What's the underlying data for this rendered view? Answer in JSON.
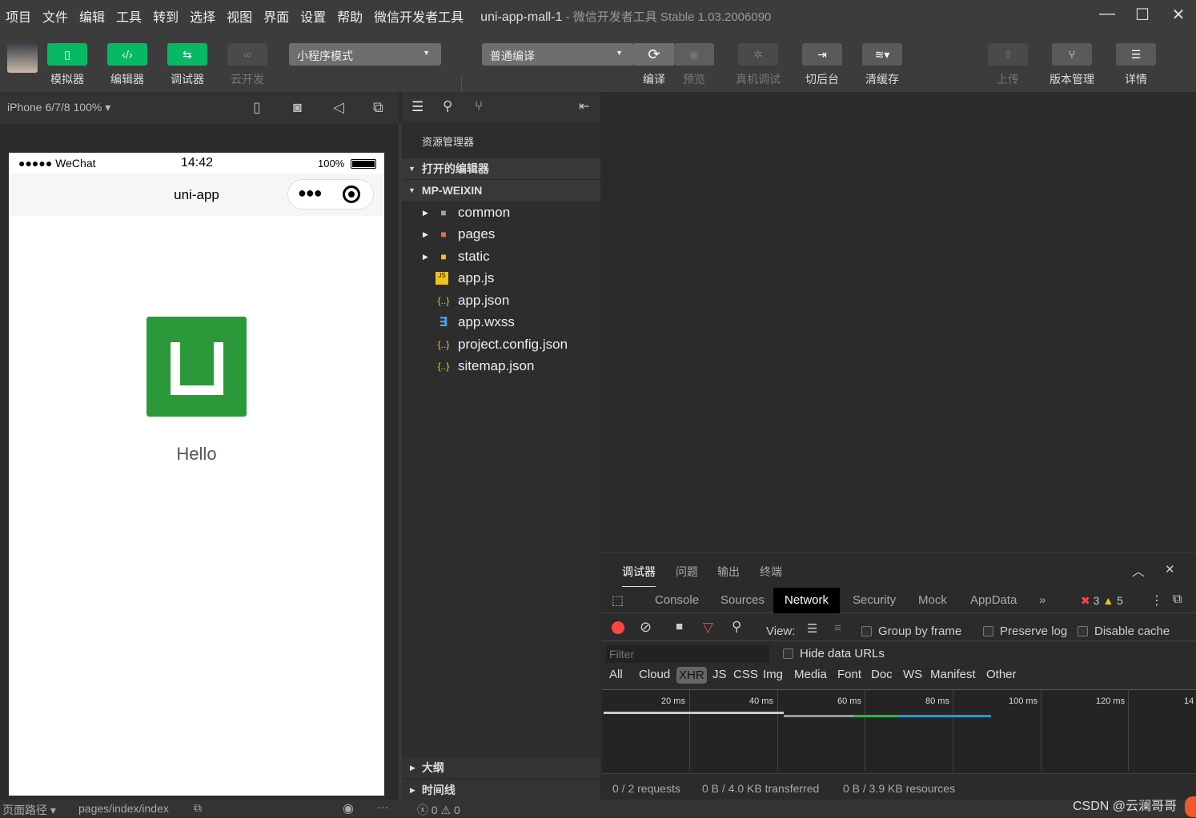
{
  "menu": [
    "项目",
    "文件",
    "编辑",
    "工具",
    "转到",
    "选择",
    "视图",
    "界面",
    "设置",
    "帮助",
    "微信开发者工具"
  ],
  "title": {
    "project": "uni-app-mall-1",
    "app": " - 微信开发者工具 Stable 1.03.2006090"
  },
  "toolbar": {
    "simulator": "模拟器",
    "editor": "编辑器",
    "debugger": "调试器",
    "cloud": "云开发",
    "mode": "小程序模式",
    "compile_mode": "普通编译",
    "compile": "编译",
    "preview": "预览",
    "remote_debug": "真机调试",
    "background": "切后台",
    "clear_cache": "清缓存",
    "upload": "上传",
    "version": "版本管理",
    "details": "详情"
  },
  "simulator": {
    "device": "iPhone 6/7/8 100%",
    "carrier": "●●●●● WeChat",
    "time": "14:42",
    "battery": "100%",
    "nav_title": "uni-app",
    "hello": "Hello"
  },
  "explorer": {
    "title": "资源管理器",
    "open_editors": "打开的编辑器",
    "project": "MP-WEIXIN",
    "outline": "大纲",
    "timeline": "时间线",
    "items": [
      {
        "name": "common",
        "icon": "folder-icon"
      },
      {
        "name": "pages",
        "icon": "folder-pages-icon"
      },
      {
        "name": "static",
        "icon": "folder-static-icon"
      },
      {
        "name": "app.js",
        "icon": "js-file-icon"
      },
      {
        "name": "app.json",
        "icon": "json-file-icon"
      },
      {
        "name": "app.wxss",
        "icon": "css-file-icon"
      },
      {
        "name": "project.config.json",
        "icon": "json-file-icon"
      },
      {
        "name": "sitemap.json",
        "icon": "json-file-icon"
      }
    ]
  },
  "devtools": {
    "tabs": [
      "调试器",
      "问题",
      "输出",
      "终端"
    ],
    "panels": [
      "Console",
      "Sources",
      "Network",
      "Security",
      "Mock",
      "AppData"
    ],
    "active_panel": "Network",
    "errors": "3",
    "warnings": "5",
    "view_label": "View:",
    "group_by_frame": "Group by frame",
    "preserve_log": "Preserve log",
    "disable_cache": "Disable cache",
    "filter_placeholder": "Filter",
    "hide_data_urls": "Hide data URLs",
    "filters": [
      "All",
      "Cloud",
      "XHR",
      "JS",
      "CSS",
      "Img",
      "Media",
      "Font",
      "Doc",
      "WS",
      "Manifest",
      "Other"
    ],
    "active_filter": "XHR",
    "ticks": [
      "20 ms",
      "40 ms",
      "60 ms",
      "80 ms",
      "100 ms",
      "120 ms",
      "14"
    ],
    "summary": {
      "requests": "0 / 2 requests",
      "transferred": "0 B / 4.0 KB transferred",
      "resources": "0 B / 3.9 KB resources"
    }
  },
  "statusbar": {
    "page_path_label": "页面路径",
    "page_path": "pages/index/index",
    "errors": "0",
    "warnings": "0",
    "watermark": "CSDN @云澜哥哥"
  },
  "colors": {
    "accent_green": "#07b963",
    "record_red": "#ff4444",
    "logo_green": "#2b9939"
  }
}
